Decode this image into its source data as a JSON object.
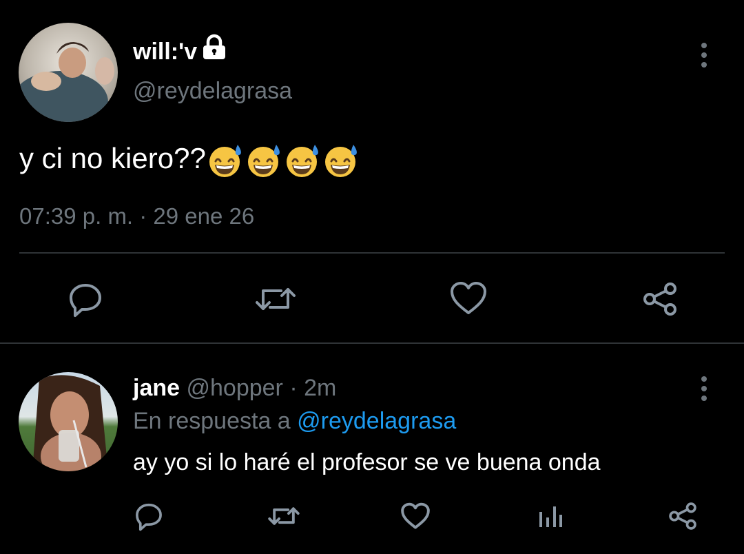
{
  "tweet": {
    "display_name": "will:'v",
    "handle": "@reydelagrasa",
    "text": "y ci no kiero??",
    "emoji": [
      "grinning-face-with-sweat",
      "grinning-face-with-sweat",
      "grinning-face-with-sweat",
      "grinning-face-with-sweat"
    ],
    "timestamp": "07:39 p. m. · 29 ene 26",
    "locked": true,
    "icons": {
      "lock": "lock-icon",
      "more": "more-vertical-icon",
      "reply": "reply-icon",
      "retweet": "retweet-icon",
      "like": "like-icon",
      "share": "share-icon"
    }
  },
  "reply": {
    "display_name": "jane",
    "handle": "@hopper",
    "separator": "·",
    "time": "2m",
    "replying_to_label": "En respuesta a",
    "replying_to_handle": "@reydelagrasa",
    "text": "ay yo si lo haré el profesor se ve buena onda",
    "icons": {
      "reply": "reply-icon",
      "retweet": "retweet-icon",
      "like": "like-icon",
      "stats": "stats-icon",
      "share": "share-icon",
      "more": "more-vertical-icon"
    }
  },
  "colors": {
    "background": "#000000",
    "text_primary": "#ffffff",
    "text_secondary": "#6e767d",
    "link": "#1d9bf0",
    "divider": "#2f3336",
    "icon": "#8b98a5"
  }
}
